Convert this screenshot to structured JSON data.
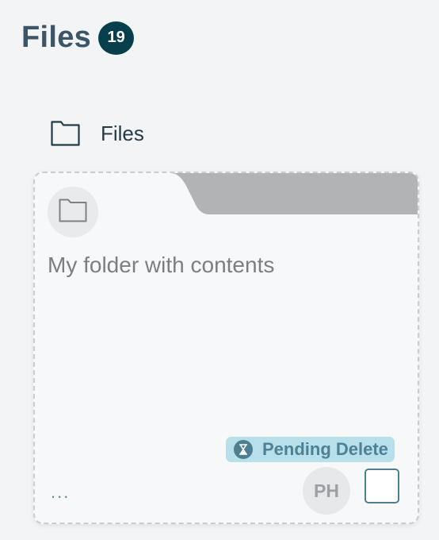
{
  "header": {
    "title": "Files",
    "count": "19"
  },
  "breadcrumb": {
    "label": "Files",
    "icon": "folder-icon"
  },
  "card": {
    "icon": "folder-icon",
    "title": "My folder with contents",
    "status": {
      "label": "Pending Delete",
      "icon": "hourglass-icon"
    },
    "more_label": "...",
    "avatar_initials": "PH",
    "checkbox_checked": false
  },
  "colors": {
    "title": "#3d5566",
    "badge_bg": "#073f4d",
    "status_bg": "#b7e0ea",
    "status_text": "#4e8193",
    "tab_gray": "#b2b3b5"
  }
}
